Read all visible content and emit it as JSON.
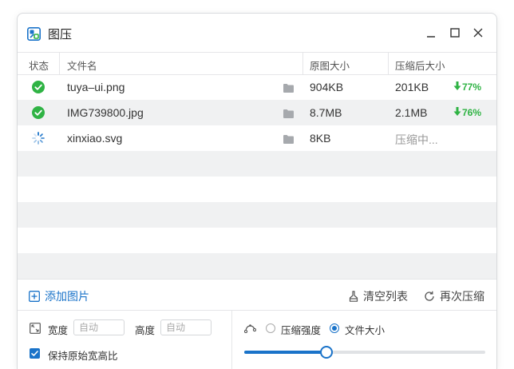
{
  "app": {
    "title": "图压",
    "accent_color": "#1a73c9",
    "success_color": "#2fb344",
    "window_controls": [
      "minimize-icon",
      "maximize-icon",
      "close-icon"
    ]
  },
  "table": {
    "columns": [
      "状态",
      "文件名",
      "原图大小",
      "压缩后大小"
    ],
    "rows": [
      {
        "status": "done",
        "status_icon": "check-circle-icon",
        "name": "tuya–ui.png",
        "original_size": "904KB",
        "compressed_size": "201KB",
        "reduction": "77%"
      },
      {
        "status": "done",
        "status_icon": "check-circle-icon",
        "name": "IMG739800.jpg",
        "original_size": "8.7MB",
        "compressed_size": "2.1MB",
        "reduction": "76%"
      },
      {
        "status": "processing",
        "status_icon": "spinner-icon",
        "name": "xinxiao.svg",
        "original_size": "8KB",
        "compressed_size": "压缩中...",
        "reduction": ""
      }
    ],
    "empty_rows": 5
  },
  "toolbar": {
    "add_label": "添加图片",
    "clear_label": "清空列表",
    "recompress_label": "再次压缩"
  },
  "settings": {
    "width_label": "宽度",
    "width_placeholder": "自动",
    "height_label": "高度",
    "height_placeholder": "自动",
    "keep_ratio_label": "保持原始宽高比",
    "keep_ratio_checked": true,
    "mode_options": [
      "压缩强度",
      "文件大小"
    ],
    "mode_selected": "文件大小",
    "slider_value": 0.34
  }
}
